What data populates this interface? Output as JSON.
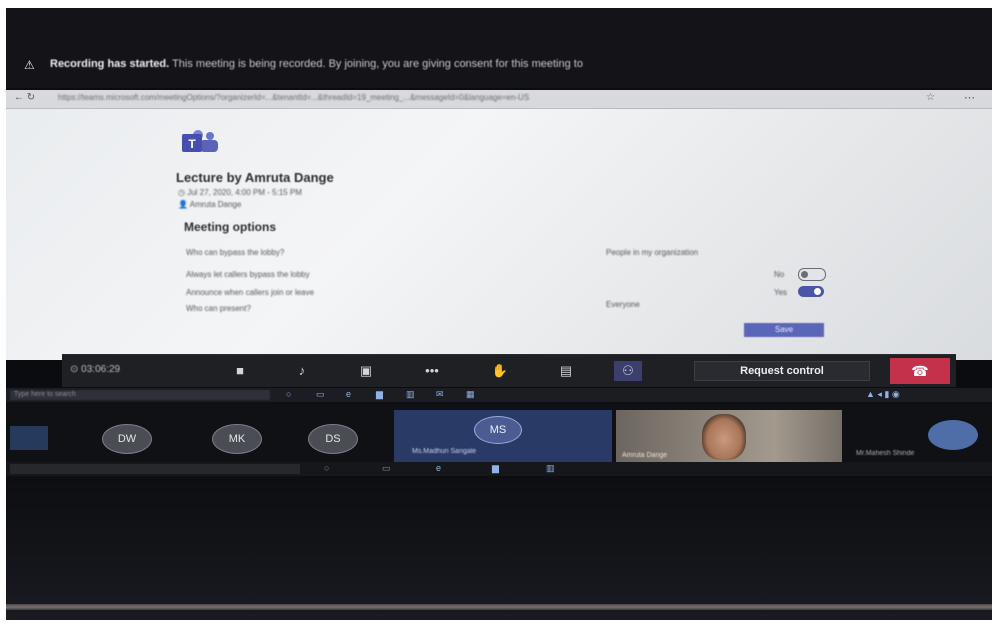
{
  "recording_banner": {
    "warning_icon": "⚠",
    "bold_text": "Recording has started.",
    "message": "This meeting is being recorded. By joining, you are giving consent for this meeting to"
  },
  "browser": {
    "nav_icons": "←  ↻",
    "url": "https://teams.microsoft.com/meetingOptions/?organizerId=...&tenantId=...&threadId=19_meeting_...&messageId=0&language=en-US",
    "star_icon": "☆",
    "menu_icon": "⋯"
  },
  "meeting": {
    "logo_icon": "teams-logo-icon",
    "title": "Lecture by Amruta Dange",
    "date": "Jul 27, 2020, 4:00 PM - 5:15 PM",
    "organizer": "Amruta Dange",
    "options_title": "Meeting options",
    "options": [
      {
        "label": "Who can bypass the lobby?",
        "value": "People in my organization"
      },
      {
        "label": "Always let callers bypass the lobby",
        "value": "No"
      },
      {
        "label": "Announce when callers join or leave",
        "value": "Yes"
      },
      {
        "label": "Who can present?",
        "value": "Everyone"
      }
    ],
    "save_label": "Save"
  },
  "call_bar": {
    "timer": "03:06:29",
    "request_control_label": "Request control",
    "hangup_icon": "phone-hangup-icon",
    "icons": [
      "video-icon",
      "mic-icon",
      "share-screen-icon",
      "more-icon",
      "raise-hand-icon",
      "chat-icon",
      "participants-icon"
    ]
  },
  "taskbar": {
    "search_placeholder": "Type here to search"
  },
  "participants": [
    {
      "initials": "DW"
    },
    {
      "initials": "MK"
    },
    {
      "initials": "DS"
    },
    {
      "initials": "MS",
      "name": "Ms.Madhuri Sangale"
    },
    {
      "name": "Amruta Dange"
    },
    {
      "name": "Mr.Mahesh Shinde"
    }
  ],
  "colors": {
    "teams_purple": "#4b55a8",
    "hangup_red": "#c4314b",
    "callbar_bg": "#1f2024"
  }
}
